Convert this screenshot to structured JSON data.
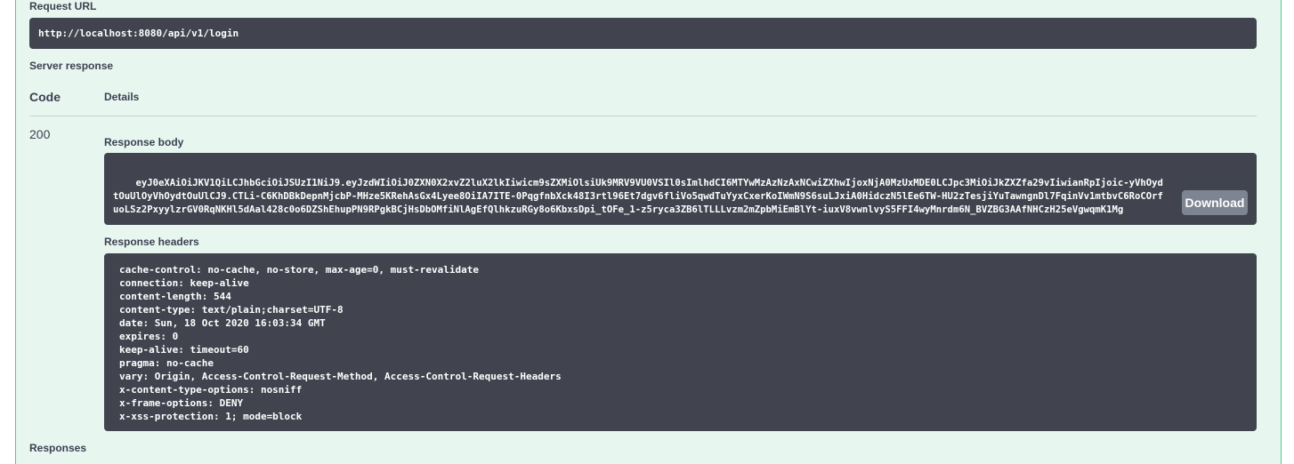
{
  "request_url": {
    "label": "Request URL",
    "value": "http://localhost:8080/api/v1/login"
  },
  "server_response": {
    "label": "Server response",
    "code_header": "Code",
    "details_header": "Details",
    "code": "200",
    "response_body": {
      "label": "Response body",
      "value": "eyJ0eXAiOiJKV1QiLCJhbGciOiJSUzI1NiJ9.eyJzdWIiOiJ0ZXN0X2xvZ2luX2lkIiwicm9sZXMiOlsiUk9MRV9VU0VSIl0sImlhdCI6MTYwMzAzNzAxNCwiZXhwIjoxNjA0MzUxMDE0LCJpc3MiOiJkZXZfa29vIiwianRpIjoic-yVhOydtOuUlOyVhOydtOuUlCJ9.CTLi-C6KhDBkDepnMjcbP-MHze5KRehAsGx4Lyee8OiIA7ITE-0PqgfnbXck48I3rtl96Et7dgv6fliVo5qwdTuYyxCxerKoIWmN9S6suLJxiA0HidczN5lEe6TW-HU2zTesjiYuTawngnDl7FqinVv1mtbvC6RoCOrfuoLSz2PxyylzrGV0RqNKHl5dAal428c0o6DZShEhupPN9RPgkBCjHsDbOMfiNlAgEfQlhkzuRGy8o6KbxsDpi_tOFe_1-z5ryca3ZB6lTLLLvzm2mZpbMiEmBlYt-iuxV8vwnlvyS5FFI4wyMnrdm6N_BVZBG3AAfNHCzH25eVgwqmK1Mg",
      "download_label": "Download"
    },
    "response_headers": {
      "label": "Response headers",
      "lines": [
        "cache-control: no-cache, no-store, max-age=0, must-revalidate",
        "connection: keep-alive",
        "content-length: 544",
        "content-type: text/plain;charset=UTF-8",
        "date: Sun, 18 Oct 2020 16:03:34 GMT",
        "expires: 0",
        "keep-alive: timeout=60",
        "pragma: no-cache",
        "vary: Origin, Access-Control-Request-Method, Access-Control-Request-Headers",
        "x-content-type-options: nosniff",
        "x-frame-options: DENY",
        "x-xss-protection: 1; mode=block"
      ]
    }
  },
  "responses_label": "Responses",
  "colors": {
    "panel_bg": "#e8f6f0",
    "panel_border": "#49cc90",
    "code_block_bg": "#41444e",
    "download_button_bg": "#7d8492",
    "text": "#3b4151"
  }
}
